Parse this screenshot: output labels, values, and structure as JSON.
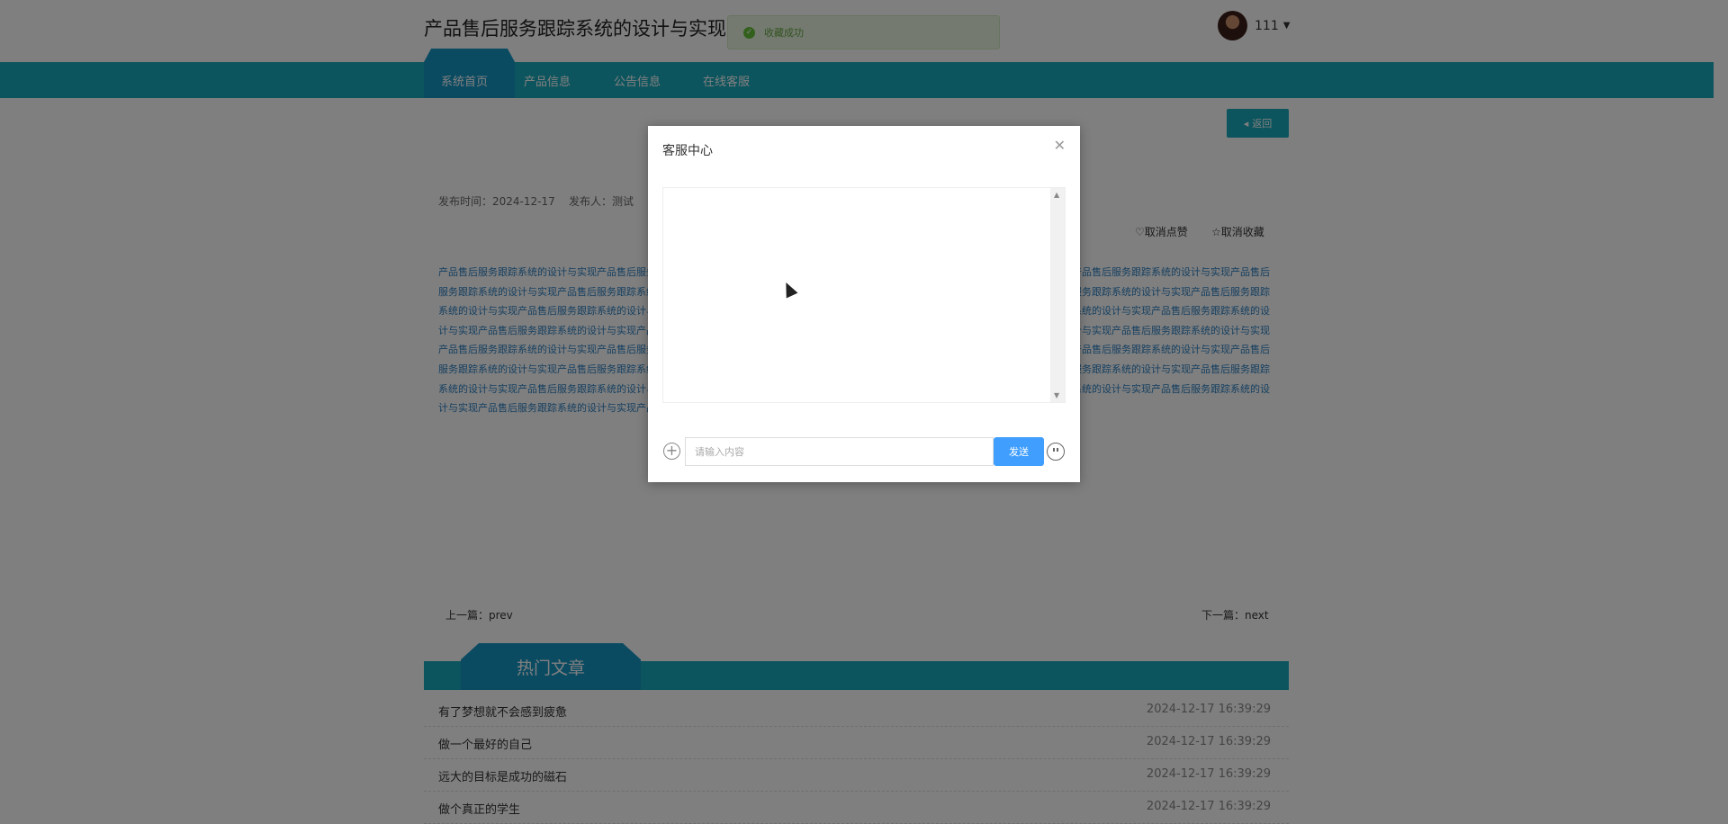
{
  "header": {
    "site_title": "产品售后服务跟踪系统的设计与实现",
    "toast": "收藏成功",
    "user": {
      "name": "111"
    }
  },
  "nav": {
    "items": [
      {
        "label": "系统首页",
        "active": true
      },
      {
        "label": "产品信息",
        "active": false
      },
      {
        "label": "公告信息",
        "active": false
      },
      {
        "label": "在线客服",
        "active": false
      }
    ]
  },
  "detail": {
    "back_label": "返回",
    "publish_time": "发布时间：2024-12-17",
    "publisher": "发布人：测试",
    "unlike_label": "取消点赞",
    "unfavorite_label": "取消收藏",
    "content_repeat": "产品售后服务跟踪系统的设计与实现",
    "prev": "上一篇：prev",
    "next": "下一篇：next"
  },
  "hot": {
    "title": "热门文章",
    "items": [
      {
        "title": "有了梦想就不会感到疲惫",
        "date": "2024-12-17 16:39:29"
      },
      {
        "title": "做一个最好的自己",
        "date": "2024-12-17 16:39:29"
      },
      {
        "title": "远大的目标是成功的磁石",
        "date": "2024-12-17 16:39:29"
      },
      {
        "title": "做个真正的学生",
        "date": "2024-12-17 16:39:29"
      }
    ]
  },
  "modal": {
    "title": "客服中心",
    "input_placeholder": "请输入内容",
    "send_label": "发送"
  },
  "colors": {
    "teal": "#1aaabd",
    "primary": "#409eff",
    "success": "#67c23a"
  }
}
